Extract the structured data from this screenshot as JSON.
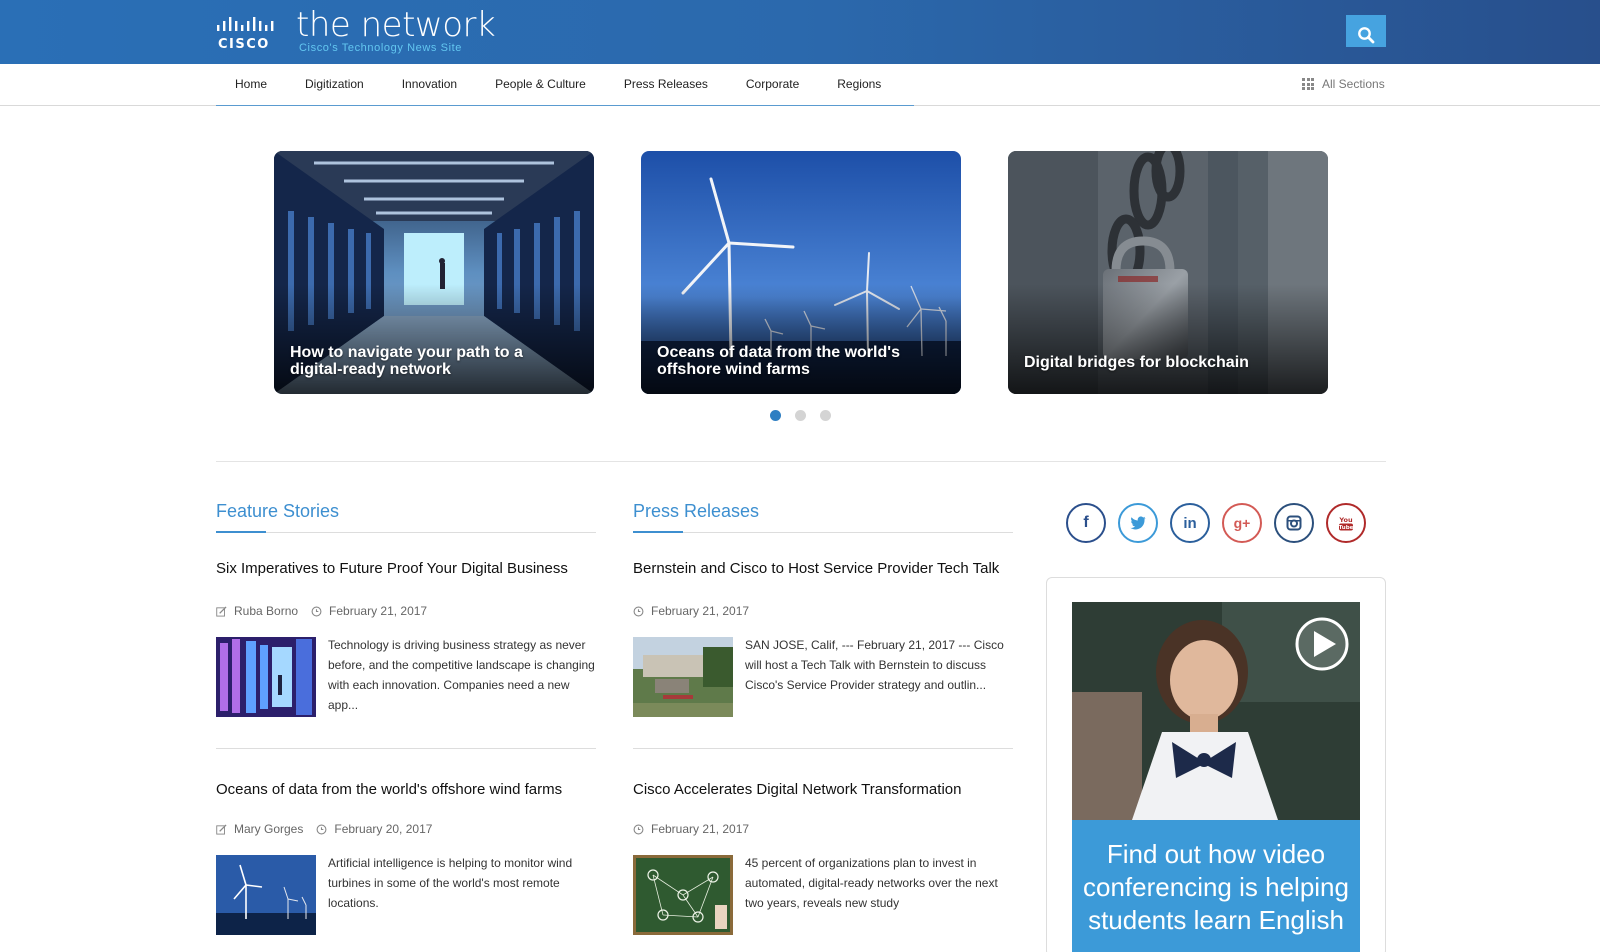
{
  "header": {
    "logo_text": "CISCO",
    "title": "the network",
    "subtitle": "Cisco's Technology News Site",
    "search_icon": "search-icon"
  },
  "nav": {
    "items": [
      "Home",
      "Digitization",
      "Innovation",
      "People & Culture",
      "Press Releases",
      "Corporate",
      "Regions"
    ],
    "all_sections": "All Sections",
    "active": "Home"
  },
  "carousel": {
    "cards": [
      {
        "caption": "How to navigate your path to a digital-ready network"
      },
      {
        "caption": "Oceans of data from the world's offshore wind farms"
      },
      {
        "caption": "Digital bridges for blockchain"
      }
    ],
    "active_dot": 1,
    "dot_count": 3
  },
  "feature": {
    "title": "Feature Stories",
    "stories": [
      {
        "title": "Six Imperatives to Future Proof Your Digital Business",
        "author": "Ruba Borno",
        "date": "February 21, 2017",
        "excerpt": "Technology is driving business strategy as never before, and the competitive landscape is changing with each innovation. Companies need a new app..."
      },
      {
        "title": "Oceans of data from the world's offshore wind farms",
        "author": "Mary Gorges",
        "date": "February 20, 2017",
        "excerpt": "Artificial intelligence is helping to monitor wind turbines in some of the world's most remote locations."
      }
    ]
  },
  "press": {
    "title": "Press Releases",
    "stories": [
      {
        "title": "Bernstein and Cisco to Host Service Provider Tech Talk",
        "date": "February 21, 2017",
        "excerpt": "SAN JOSE, Calif, --- February 21, 2017 --- Cisco will host a Tech Talk with Bernstein to discuss Cisco's Service Provider strategy and outlin..."
      },
      {
        "title": "Cisco Accelerates Digital Network Transformation",
        "date": "February 21, 2017",
        "excerpt": "45 percent of organizations plan to invest in automated, digital-ready networks over the next two years, reveals new study"
      }
    ]
  },
  "social": {
    "icons": [
      "facebook-icon",
      "twitter-icon",
      "linkedin-icon",
      "google-plus-icon",
      "instagram-icon",
      "youtube-icon"
    ],
    "colors": {
      "facebook": "#2b4f8c",
      "twitter": "#3c9ad8",
      "linkedin": "#2b5f9c",
      "googleplus": "#d35a55",
      "instagram": "#2b4f7c",
      "youtube": "#b02a2a"
    },
    "labels": {
      "facebook": "f",
      "linkedin": "in",
      "googleplus": "g+",
      "youtube_top": "You",
      "youtube_bottom": "Tube"
    }
  },
  "promo": {
    "text": "Find out how video conferencing is helping students learn English",
    "play_icon": "play-icon"
  },
  "colors": {
    "header_blue": "#2a6fb6",
    "accent": "#3d8fd0",
    "search_button": "#46a3e0",
    "promo_blue": "#3c9ad8"
  }
}
